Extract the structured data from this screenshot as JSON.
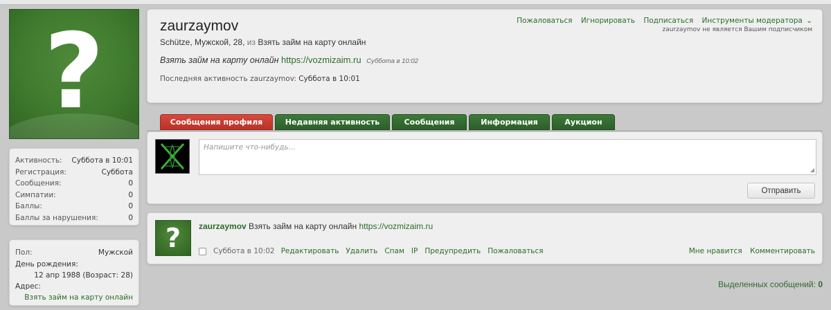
{
  "sidebar": {
    "stats": [
      {
        "key": "Активность:",
        "value": "Суббота в 10:01"
      },
      {
        "key": "Регистрация:",
        "value": "Суббота"
      },
      {
        "key": "Сообщения:",
        "value": "0"
      },
      {
        "key": "Симпатии:",
        "value": "0"
      },
      {
        "key": "Баллы:",
        "value": "0"
      },
      {
        "key": "Баллы за нарушения:",
        "value": "0"
      }
    ],
    "info": {
      "gender_label": "Пол:",
      "gender_value": "Мужской",
      "birthday_label": "День рождения:",
      "birthday_value": "12 апр 1988 (Возраст: 28)",
      "address_label": "Адрес:",
      "address_value": "Взять займ на карту онлайн"
    }
  },
  "header": {
    "username": "zaurzaymov",
    "subinfo_main": "Schütze, Мужской, 28,",
    "subinfo_from": "из",
    "subinfo_place": "Взять займ на карту онлайн",
    "status_text": "Взять займ на карту онлайн",
    "status_url": "https://vozmizaim.ru",
    "status_time": "Суббота в 10:02",
    "last_activity_label": "Последняя активность zaurzaymov:",
    "last_activity_value": "Суббота в 10:01",
    "actions": {
      "report": "Пожаловаться",
      "ignore": "Игнорировать",
      "follow": "Подписаться",
      "moderator_tools": "Инструменты модератора",
      "note": "zaurzaymov не является Вашим подписчиком"
    }
  },
  "tabs": [
    {
      "label": "Сообщения профиля",
      "active": true
    },
    {
      "label": "Недавняя активность",
      "active": false
    },
    {
      "label": "Сообщения",
      "active": false
    },
    {
      "label": "Информация",
      "active": false
    },
    {
      "label": "Аукцион",
      "active": false
    }
  ],
  "postbox": {
    "placeholder": "Напишите что-нибудь...",
    "submit_label": "Отправить"
  },
  "message": {
    "author": "zaurzaymov",
    "text": "Взять займ на карту онлайн",
    "url": "https://vozmizaim.ru",
    "time": "Суббота в 10:02",
    "actions": [
      "Редактировать",
      "Удалить",
      "Спам",
      "IP",
      "Предупредить",
      "Пожаловаться"
    ],
    "like_label": "Мне нравится",
    "comment_label": "Комментировать"
  },
  "selected": {
    "label": "Выделенных сообщений:",
    "count": "0"
  },
  "colors": {
    "accent_green": "#2d6b2b",
    "tab_green": "#2c5f2a",
    "tab_active_red": "#c23a2f",
    "background": "#c9c9c9"
  }
}
